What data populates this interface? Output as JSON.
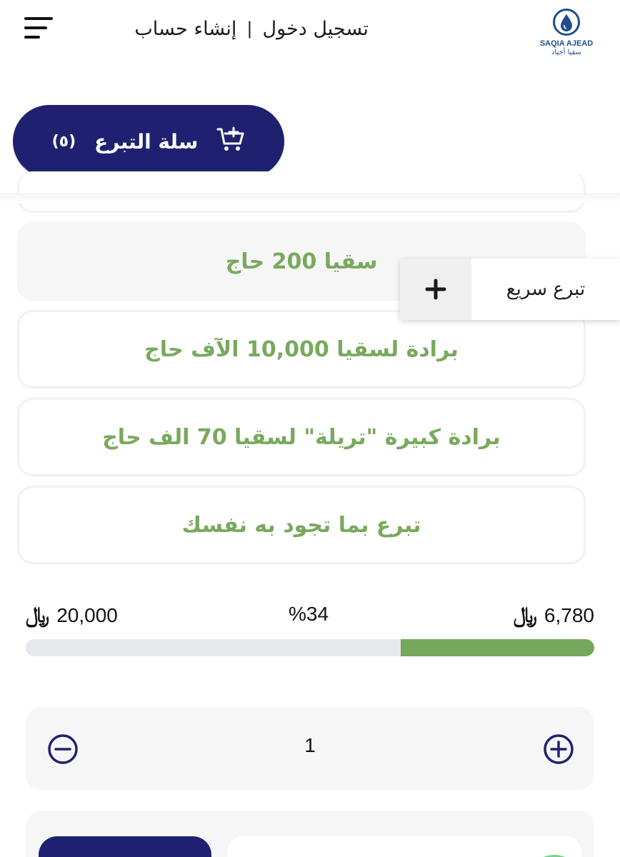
{
  "header": {
    "logo": {
      "en": "SAQIA AJEAD",
      "ar": "سقيا أجياد",
      "icon": "water-drop-icon"
    },
    "login_label": "تسجيل دخول",
    "separator": "|",
    "register_label": "إنشاء حساب",
    "menu_icon": "hamburger-menu-icon"
  },
  "cart": {
    "label": "سلة التبرع",
    "count": "(٥)",
    "icon": "cart-plus-icon"
  },
  "options": [
    {
      "label": "سقيا 200 حاج",
      "selected": true
    },
    {
      "label": "برادة لسقيا 10,000 الآف حاج",
      "selected": false
    },
    {
      "label": "برادة كبيرة \"تريلة\" لسقيا 70 الف حاج",
      "selected": false
    },
    {
      "label": "تبرع بما تجود به نفسك",
      "selected": false
    }
  ],
  "quick_donate": {
    "label": "تبرع سريع",
    "icon": "plus-icon"
  },
  "progress": {
    "goal": "20,000",
    "percent_label": "%34",
    "raised": "6,780",
    "currency_symbol": "﷼",
    "fraction": 0.34
  },
  "quantity": {
    "value": "1",
    "minus_icon": "minus-circle-icon",
    "plus_icon": "plus-circle-icon"
  },
  "colors": {
    "brand_navy": "#1f2170",
    "option_green": "#79a95d",
    "progress_green": "#76a85b",
    "logo_blue": "#1f4e8c"
  }
}
